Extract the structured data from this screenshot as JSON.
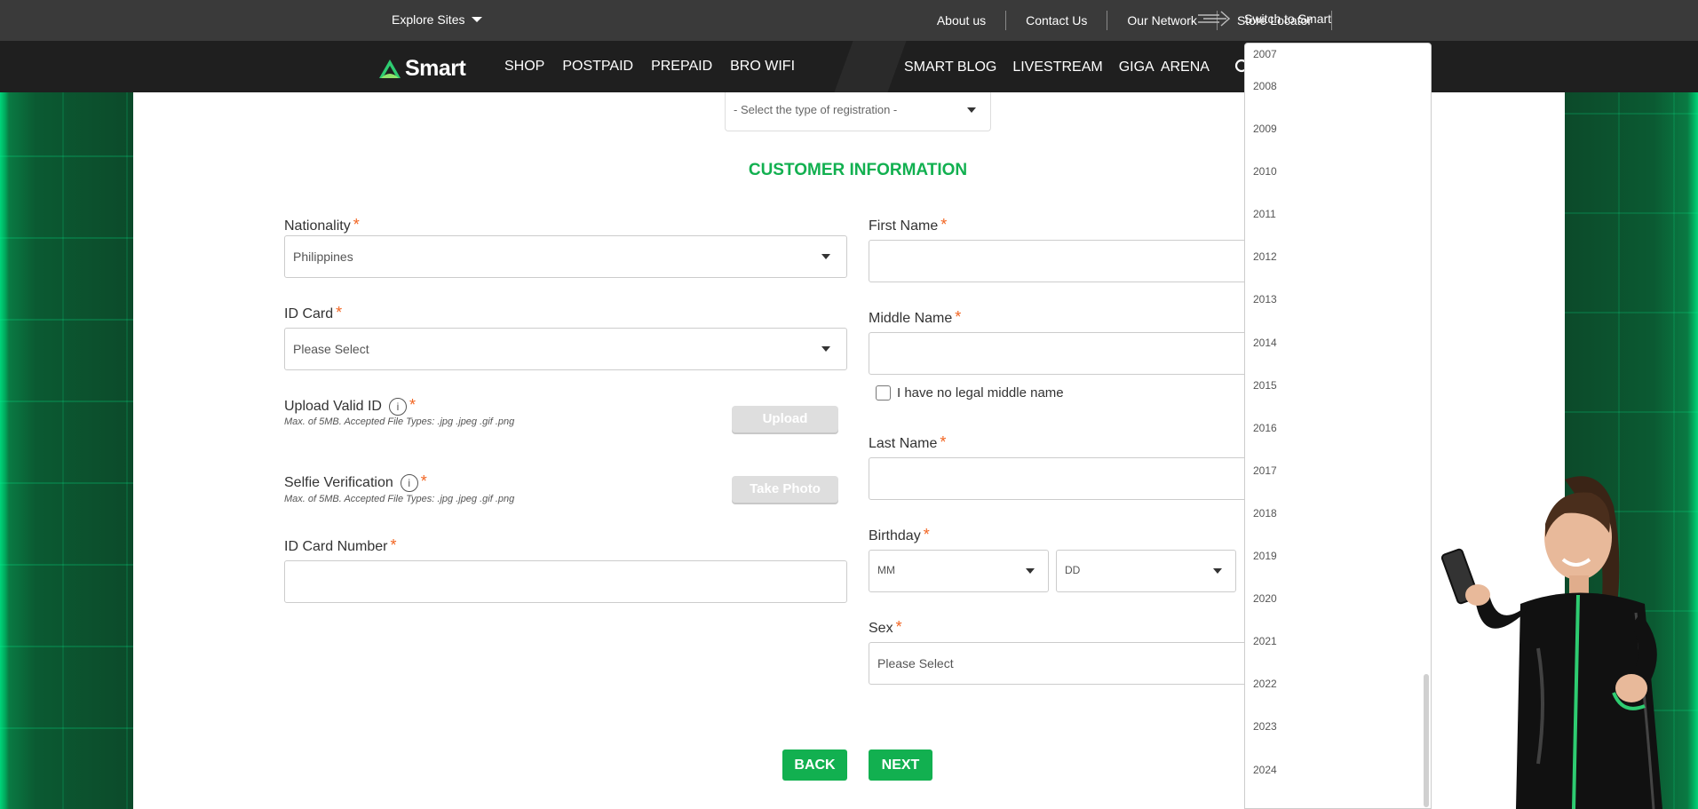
{
  "topbar": {
    "explore_label": "Explore Sites",
    "links": [
      "About us",
      "Contact Us",
      "Our Network",
      "Store Locator"
    ],
    "switch_label": "Switch to Smart"
  },
  "nav": {
    "logo_text": "Smart",
    "left_items": [
      "SHOP",
      "POSTPAID",
      "PREPAID",
      "BRO WIFI"
    ],
    "right_items": [
      "SMART BLOG",
      "LIVESTREAM",
      "GIGA  ARENA"
    ]
  },
  "form": {
    "registration_placeholder": "- Select the type of registration -",
    "section_title": "CUSTOMER INFORMATION",
    "nationality": {
      "label": "Nationality",
      "value": "Philippines"
    },
    "id_card": {
      "label": "ID Card",
      "value": "Please Select"
    },
    "upload_valid_id": {
      "label": "Upload Valid ID",
      "hint": "Max. of 5MB. Accepted File Types: .jpg .jpeg .gif .png",
      "button": "Upload"
    },
    "selfie": {
      "label": "Selfie Verification",
      "hint": "Max. of 5MB. Accepted File Types: .jpg .jpeg .gif  .png",
      "button": "Take Photo"
    },
    "id_card_number": {
      "label": "ID Card Number",
      "value": ""
    },
    "first_name": {
      "label": "First Name",
      "value": ""
    },
    "middle_name": {
      "label": "Middle Name",
      "value": ""
    },
    "no_middle_name": "I have no legal middle name",
    "last_name": {
      "label": "Last Name",
      "value": ""
    },
    "birthday": {
      "label": "Birthday",
      "month": "MM",
      "day": "DD"
    },
    "sex": {
      "label": "Sex",
      "value": "Please Select"
    },
    "back_label": "BACK",
    "next_label": "NEXT",
    "required_mark": "*"
  },
  "year_dropdown": {
    "options": [
      "2007",
      "2008",
      "2009",
      "2010",
      "2011",
      "2012",
      "2013",
      "2014",
      "2015",
      "2016",
      "2017",
      "2018",
      "2019",
      "2020",
      "2021",
      "2022",
      "2023",
      "2024"
    ]
  },
  "colors": {
    "brand_green": "#12b050",
    "required": "#f26522",
    "nav_dark": "#1f1f1f",
    "topbar": "#3a3a3a"
  }
}
